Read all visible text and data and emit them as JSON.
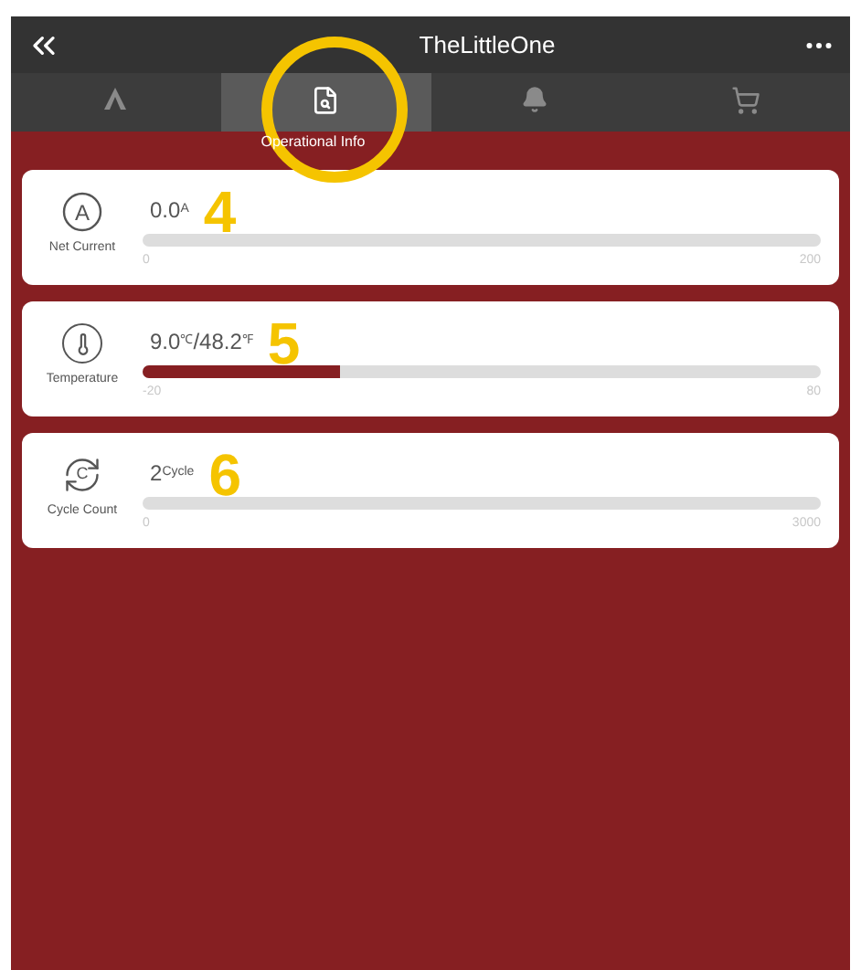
{
  "header": {
    "title": "TheLittleOne"
  },
  "tabs": [
    {
      "kind": "lambda",
      "selected": false
    },
    {
      "kind": "document",
      "selected": true,
      "label": "Operational Info"
    },
    {
      "kind": "bell",
      "selected": false
    },
    {
      "kind": "cart",
      "selected": false
    }
  ],
  "gauges": [
    {
      "kind": "current",
      "icon_text": "A",
      "name": "Net Current",
      "value": "0.0$^{A}$",
      "level": 0,
      "min": "0",
      "max": "200",
      "annotation": "4"
    },
    {
      "kind": "thermometer",
      "name": "Temperature",
      "value": "9.0$^{℃}$/48.2$^{℉}$",
      "level": 0.29,
      "min": "-20",
      "max": "80",
      "annotation": "5"
    },
    {
      "kind": "cycle",
      "icon_text": "C",
      "name": "Cycle Count",
      "value": "2$^{Cycle}$",
      "level": 0,
      "min": "0",
      "max": "3000",
      "annotation": "6"
    }
  ]
}
